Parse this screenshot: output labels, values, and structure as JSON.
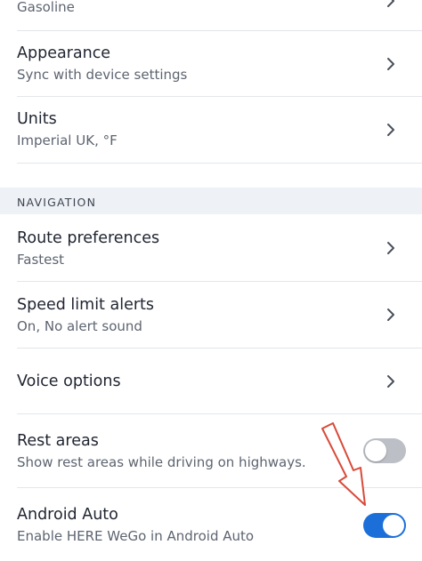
{
  "settings": {
    "fuel": {
      "subtitle": "Gasoline"
    },
    "appearance": {
      "title": "Appearance",
      "subtitle": "Sync with device settings"
    },
    "units": {
      "title": "Units",
      "subtitle": "Imperial UK, °F"
    }
  },
  "navigation": {
    "header": "NAVIGATION",
    "route": {
      "title": "Route preferences",
      "subtitle": "Fastest"
    },
    "speed": {
      "title": "Speed limit alerts",
      "subtitle": "On, No alert sound"
    },
    "voice": {
      "title": "Voice options"
    },
    "rest_areas": {
      "title": "Rest areas",
      "subtitle": "Show rest areas while driving on highways.",
      "enabled": false
    },
    "android_auto": {
      "title": "Android Auto",
      "subtitle": "Enable HERE WeGo in Android Auto",
      "enabled": true
    }
  },
  "colors": {
    "toggle_on": "#1c6fd8",
    "toggle_off": "#bcc0c6",
    "annotation_arrow": "#d94a3a"
  }
}
